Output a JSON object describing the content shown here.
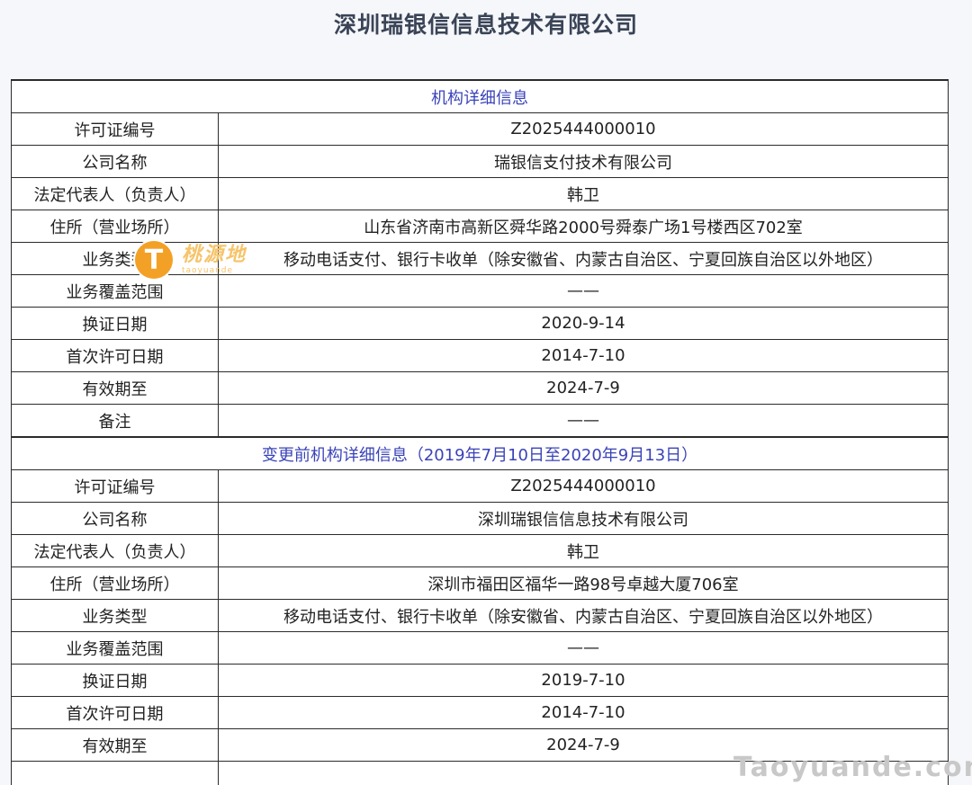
{
  "title": "深圳瑞银信信息技术有限公司",
  "sections": [
    {
      "heading": "机构详细信息",
      "rows": [
        {
          "label": "许可证编号",
          "value": "Z2025444000010"
        },
        {
          "label": "公司名称",
          "value": "瑞银信支付技术有限公司"
        },
        {
          "label": "法定代表人（负责人）",
          "value": "韩卫"
        },
        {
          "label": "住所（营业场所）",
          "value": "山东省济南市高新区舜华路2000号舜泰广场1号楼西区702室"
        },
        {
          "label": "业务类型",
          "value": "移动电话支付、银行卡收单（除安徽省、内蒙古自治区、宁夏回族自治区以外地区）"
        },
        {
          "label": "业务覆盖范围",
          "value": "——"
        },
        {
          "label": "换证日期",
          "value": "2020-9-14"
        },
        {
          "label": "首次许可日期",
          "value": "2014-7-10"
        },
        {
          "label": "有效期至",
          "value": "2024-7-9"
        },
        {
          "label": "备注",
          "value": "——"
        }
      ]
    },
    {
      "heading": "变更前机构详细信息（2019年7月10日至2020年9月13日）",
      "rows": [
        {
          "label": "许可证编号",
          "value": "Z2025444000010"
        },
        {
          "label": "公司名称",
          "value": "深圳瑞银信信息技术有限公司"
        },
        {
          "label": "法定代表人（负责人）",
          "value": "韩卫"
        },
        {
          "label": "住所（营业场所）",
          "value": "深圳市福田区福华一路98号卓越大厦706室"
        },
        {
          "label": "业务类型",
          "value": "移动电话支付、银行卡收单（除安徽省、内蒙古自治区、宁夏回族自治区以外地区）"
        },
        {
          "label": "业务覆盖范围",
          "value": "——"
        },
        {
          "label": "换证日期",
          "value": "2019-7-10"
        },
        {
          "label": "首次许可日期",
          "value": "2014-7-10"
        },
        {
          "label": "有效期至",
          "value": "2024-7-9"
        }
      ]
    }
  ],
  "watermark_left": {
    "badge": "T",
    "cn": "桃源地",
    "en": "taoyuande"
  },
  "watermark_right": "Taoyuande.com"
}
